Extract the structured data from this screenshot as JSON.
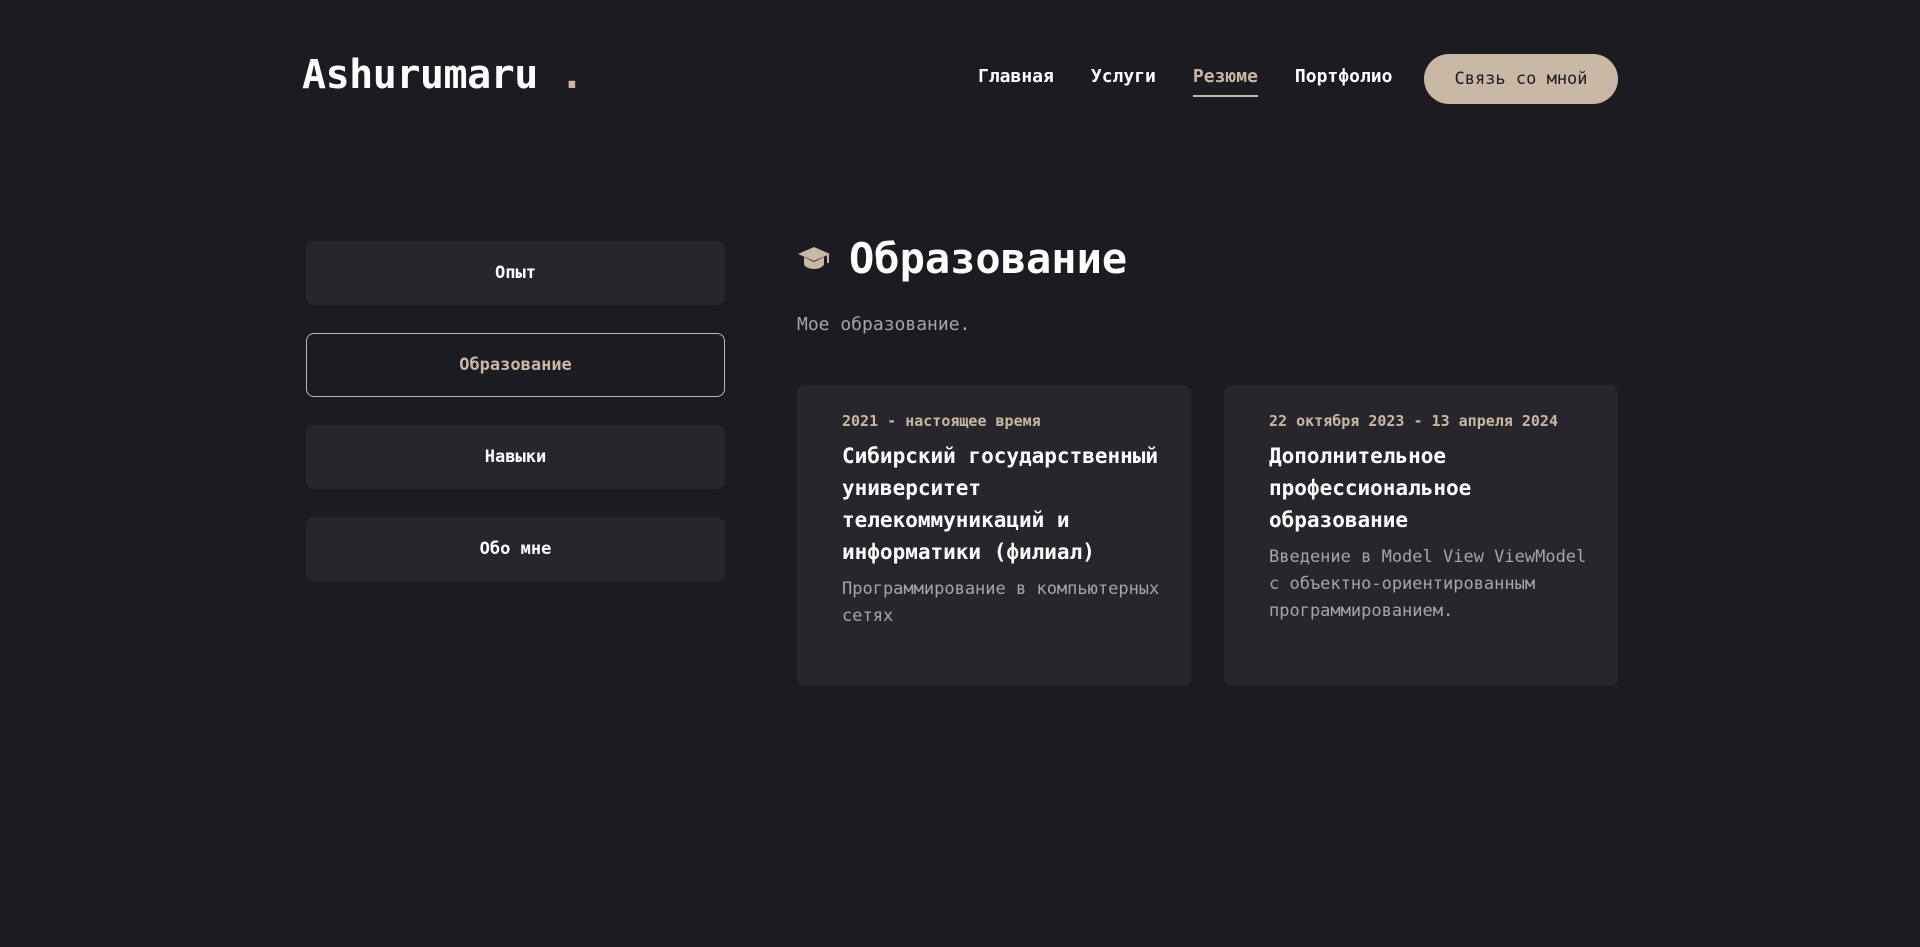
{
  "header": {
    "logo": "Ashurumaru",
    "logo_dot": ".",
    "nav": [
      {
        "label": "Главная"
      },
      {
        "label": "Услуги"
      },
      {
        "label": "Резюме"
      },
      {
        "label": "Портфолио"
      }
    ],
    "active_nav": "Резюме",
    "contact_label": "Связь со мной"
  },
  "sidebar": {
    "tabs": [
      {
        "label": "Опыт"
      },
      {
        "label": "Образование"
      },
      {
        "label": "Навыки"
      },
      {
        "label": "Обо мне"
      }
    ],
    "active_tab": "Образование"
  },
  "section": {
    "icon": "graduation-cap-icon",
    "title": "Образование",
    "subtitle": "Мое образование.",
    "cards": [
      {
        "date": "2021 - настоящее время",
        "title": "Сибирский государственный университет телекоммуникаций и информатики (филиал)",
        "description": "Программирование в компьютерных сетях"
      },
      {
        "date": "22 октября 2023 - 13 апреля 2024",
        "title": "Дополнительное профессиональное образование",
        "description": "Введение в Model View ViewModel с объектно-ориентированным программированием."
      }
    ]
  },
  "colors": {
    "background": "#1c1b22",
    "card": "#27262d",
    "accent": "#c9b8a3",
    "muted_text": "#a6a5ab",
    "text": "#ffffff"
  }
}
